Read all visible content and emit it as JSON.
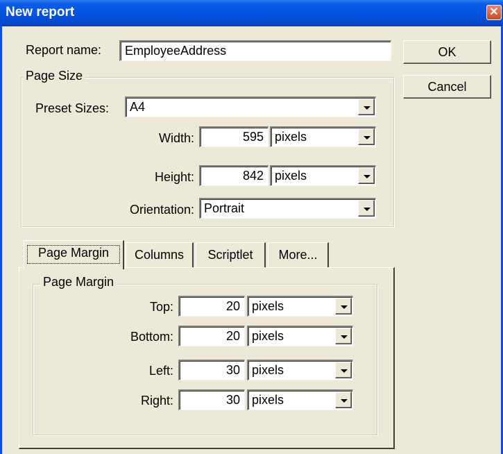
{
  "window": {
    "title": "New report",
    "close_glyph": "✕"
  },
  "report_name": {
    "label": "Report name:",
    "value": "EmployeeAddress"
  },
  "buttons": {
    "ok": "OK",
    "cancel": "Cancel"
  },
  "page_size": {
    "group_title": "Page Size",
    "preset_label": "Preset Sizes:",
    "preset_value": "A4",
    "width_label": "Width:",
    "width_value": "595",
    "width_unit": "pixels",
    "height_label": "Height:",
    "height_value": "842",
    "height_unit": "pixels",
    "orientation_label": "Orientation:",
    "orientation_value": "Portrait"
  },
  "tabs": [
    {
      "label": "Page Margin",
      "active": true
    },
    {
      "label": "Columns",
      "active": false
    },
    {
      "label": "Scriptlet",
      "active": false
    },
    {
      "label": "More...",
      "active": false
    }
  ],
  "page_margin": {
    "group_title": "Page Margin",
    "top_label": "Top:",
    "top_value": "20",
    "top_unit": "pixels",
    "bottom_label": "Bottom:",
    "bottom_value": "20",
    "bottom_unit": "pixels",
    "left_label": "Left:",
    "left_value": "30",
    "left_unit": "pixels",
    "right_label": "Right:",
    "right_value": "30",
    "right_unit": "pixels"
  },
  "colors": {
    "titlebar": "#0553e0",
    "face": "#ece9d8",
    "close": "#c94a25"
  },
  "icons": {
    "close": "close-icon",
    "dropdown": "chevron-down-icon"
  }
}
